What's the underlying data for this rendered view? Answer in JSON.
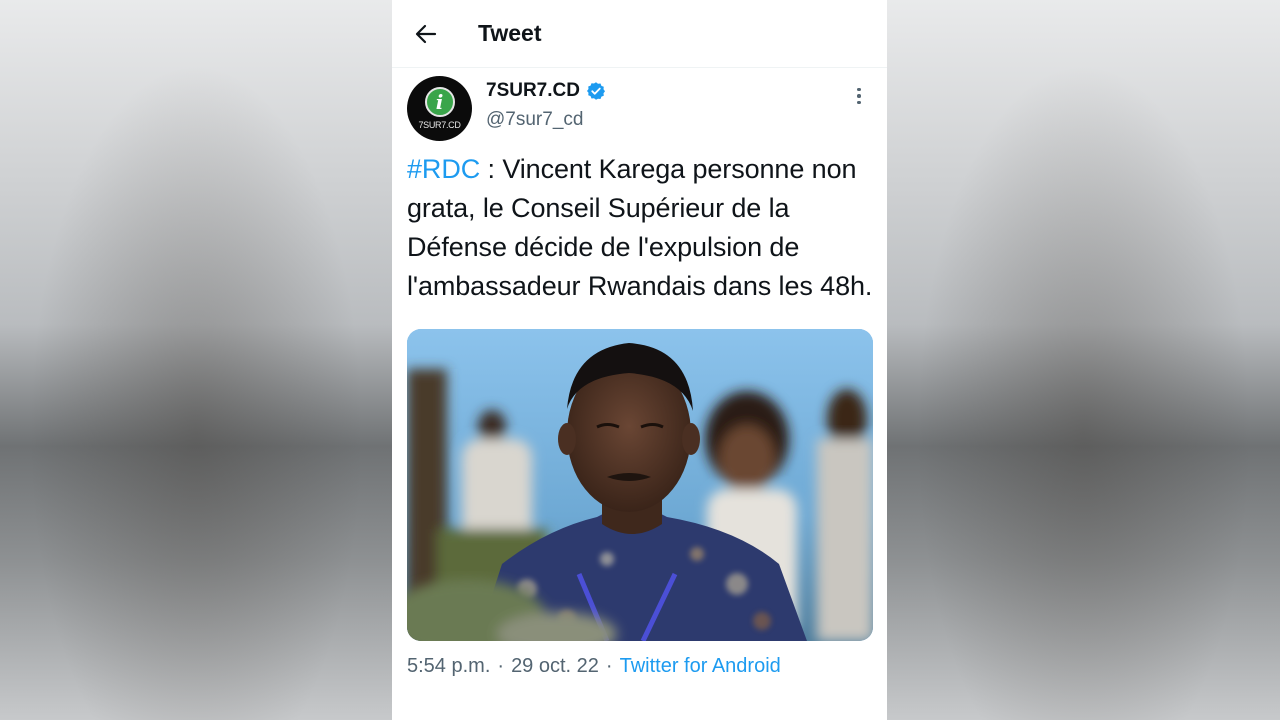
{
  "topbar": {
    "back_icon": "arrow-left-icon",
    "title": "Tweet"
  },
  "tweet": {
    "author": {
      "display_name": "7SUR7.CD",
      "handle": "@7sur7_cd",
      "verified": true,
      "avatar_text": "7SUR7.CD",
      "avatar_logo_letter": "i"
    },
    "text": {
      "hashtag": "#RDC",
      "body": " : Vincent Karega personne non grata, le Conseil Supérieur de la Défense décide de l'expulsion de l'ambassadeur Rwandais dans les 48h."
    },
    "more_icon": "more-vertical-icon",
    "meta": {
      "time": "5:54 p.m.",
      "separator": "·",
      "date": "29 oct. 22",
      "source": "Twitter for Android"
    }
  },
  "colors": {
    "accent": "#1d9bf0",
    "text_primary": "#0f1419",
    "text_secondary": "#536471",
    "avatar_green": "#3aa54a"
  }
}
